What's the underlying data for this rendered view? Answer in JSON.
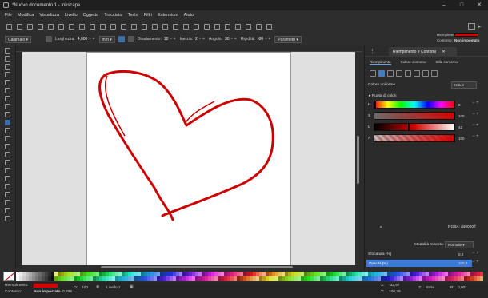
{
  "window": {
    "title": "*Nuovo documento 1 - Inkscape"
  },
  "menu": [
    "File",
    "Modifica",
    "Visualizza",
    "Livello",
    "Oggetto",
    "Tracciato",
    "Testo",
    "Filtri",
    "Estensioni",
    "Aiuto"
  ],
  "fill_indicator": {
    "fill_label": "Riempimento",
    "stroke_label": "Contorno:",
    "stroke_value": "Non impostato",
    "fill_color": "#d40000"
  },
  "controls": {
    "preset": "Calamaio",
    "width_label": "Larghezza:",
    "width_value": "4,000",
    "unit": "mm",
    "thinning_label": "Diradamento:",
    "thinning_value": "10",
    "mass_label": "Inerzia:",
    "mass_value": "2",
    "angle_label": "Angolo:",
    "angle_value": "30",
    "rigidity_label": "Rigidità:",
    "rigidity_value": "-80",
    "params_label": "Parametri"
  },
  "panel": {
    "tab_title": "Riempimento e Contorni",
    "subtabs": [
      "Riempimento",
      "Colore contorno",
      "Stile contorno"
    ],
    "heading": "Colore uniforme",
    "color_model": "HSL",
    "wheel_label": "Ruota di colori",
    "channels": [
      {
        "label": "H",
        "value": "0"
      },
      {
        "label": "S",
        "value": "100"
      },
      {
        "label": "L",
        "value": "42"
      },
      {
        "label": "A",
        "value": "100"
      }
    ],
    "rgba_label": "RGBA:",
    "rgba_value": "d40000ff",
    "blend_label": "Modalità miscela:",
    "blend_value": "Normale",
    "blur_label": "Sfocatura (%)",
    "blur_value": "0,0",
    "opacity_label": "Opacità (%)",
    "opacity_value": "100,0"
  },
  "status": {
    "fill_label": "Riempimento:",
    "stroke_label": "Contorno:",
    "stroke_value": "Non impostato",
    "stroke_width": "0,265",
    "opacity_label": "O:",
    "opacity_value": "100",
    "layer_value": "Livello 1",
    "x_label": "X:",
    "x_value": "-32,97",
    "y_label": "Y:",
    "y_value": "100,39",
    "zoom_label": "Z:",
    "zoom_value": "84%",
    "rotation_label": "R:",
    "rotation_value": "0,00°"
  }
}
